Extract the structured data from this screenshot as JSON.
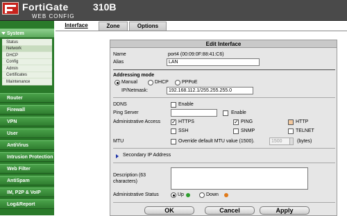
{
  "header": {
    "brand": "FortiGate",
    "model": "310B",
    "subtitle": "WEB CONFIG"
  },
  "sidebar": {
    "system": "System",
    "system_items": [
      "Status",
      "Network",
      "DHCP",
      "Config",
      "Admin",
      "Certificates",
      "Maintenance"
    ],
    "sections": [
      "Router",
      "Firewall",
      "VPN",
      "User",
      "AntiVirus",
      "Intrusion Protection",
      "Web Filter",
      "AntiSpam",
      "IM, P2P & VoIP",
      "Log&Report"
    ]
  },
  "tabs": [
    "Interface",
    "Zone",
    "Options"
  ],
  "form": {
    "title": "Edit Interface",
    "name_label": "Name",
    "name_value": "port4 (00:09:0F:88:41:C6)",
    "alias_label": "Alias",
    "alias_value": "LAN",
    "addressing_label": "Addressing mode",
    "mode_manual": "Manual",
    "mode_dhcp": "DHCP",
    "mode_pppoe": "PPPoE",
    "ipnetmask_label": "IP/Netmask:",
    "ipnetmask_value": "192.168.112.1/255.255.255.0",
    "ddns_label": "DDNS",
    "enable_label": "Enable",
    "ping_server_label": "Ping Server",
    "admin_access_label": "Administrative Access",
    "access": {
      "https": "HTTPS",
      "ping": "PING",
      "http": "HTTP",
      "ssh": "SSH",
      "snmp": "SNMP",
      "telnet": "TELNET"
    },
    "mtu_label": "MTU",
    "mtu_override": "Override default MTU value (1500).",
    "mtu_value": "1500",
    "mtu_unit": "(bytes)",
    "secondary_ip": "Secondary IP Address",
    "description_label": "Description (63 characters)",
    "admin_status_label": "Administrative Status",
    "status_up": "Up",
    "status_down": "Down"
  },
  "buttons": {
    "ok": "OK",
    "cancel": "Cancel",
    "apply": "Apply"
  },
  "colors": {
    "sidebar_green": "#2a7a2a",
    "header_gray": "#4a4a4a",
    "logo_red": "#c8231c",
    "up_green": "#2e9e2e",
    "down_orange": "#e07a1a",
    "link_blue": "#1a2fa8"
  }
}
